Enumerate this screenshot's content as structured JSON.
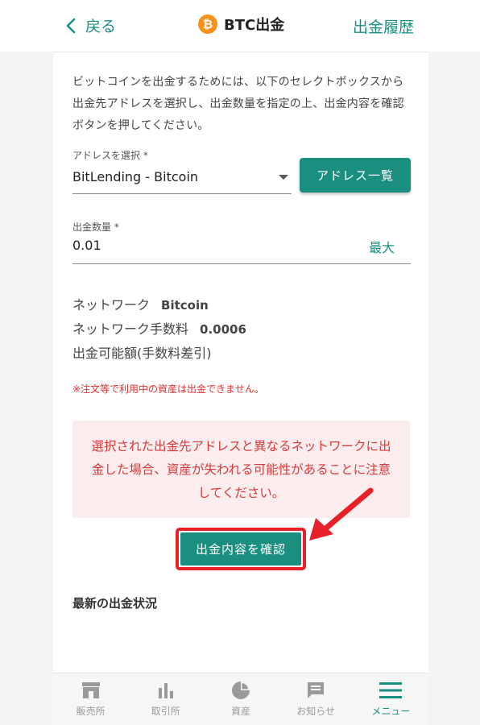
{
  "header": {
    "back_label": "戻る",
    "title": "BTC出金",
    "history_label": "出金履歴",
    "coin_icon": "bitcoin-icon",
    "coin_icon_glyph": "₿"
  },
  "form": {
    "description": "ビットコインを出金するためには、以下のセレクトボックスから出金先アドレスを選択し、出金数量を指定の上、出金内容を確認ボタンを押してください。",
    "address_label": "アドレスを選択 *",
    "address_value": "BitLending - Bitcoin",
    "address_list_button": "アドレス一覧",
    "amount_label": "出金数量 *",
    "amount_value": "0.01",
    "max_button": "最大"
  },
  "info": {
    "network_label": "ネットワーク",
    "network_value": "Bitcoin",
    "fee_label": "ネットワーク手数料",
    "fee_value": "0.0006",
    "available_label": "出金可能額(手数料差引)"
  },
  "notice_small": "※注文等で利用中の資産は出金できません。",
  "alert_text": "選択された出金先アドレスと異なるネットワークに出金した場合、資産が失われる可能性があることに注意してください。",
  "confirm_button": "出金内容を確認",
  "recent_title": "最新の出金状況",
  "nav": {
    "items": [
      {
        "label": "販売所",
        "icon": "store-icon"
      },
      {
        "label": "取引所",
        "icon": "bar-chart-icon"
      },
      {
        "label": "資産",
        "icon": "pie-chart-icon"
      },
      {
        "label": "お知らせ",
        "icon": "message-icon"
      },
      {
        "label": "メニュー",
        "icon": "menu-icon"
      }
    ]
  },
  "colors": {
    "accent": "#1a8f80",
    "warning": "#e03030",
    "highlight": "#e8202a",
    "bitcoin": "#f7931a"
  }
}
